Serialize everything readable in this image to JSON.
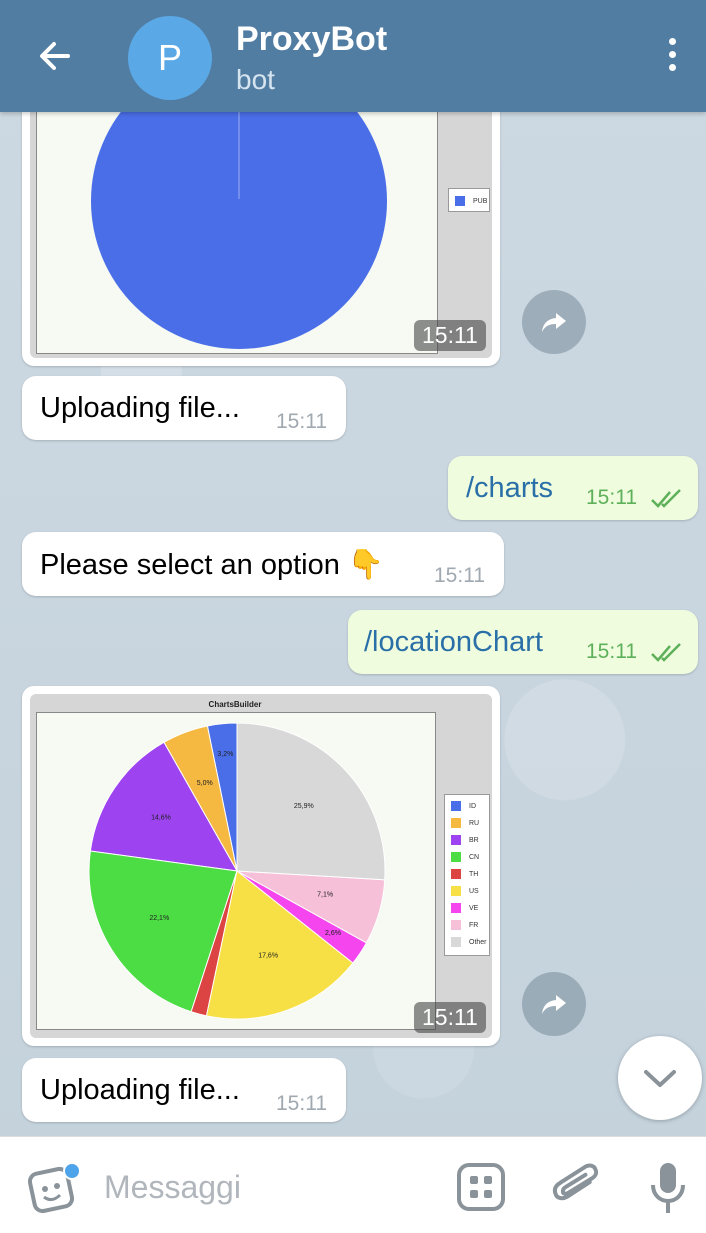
{
  "header": {
    "title": "ProxyBot",
    "subtitle": "bot",
    "avatar_letter": "P"
  },
  "messages": [
    {
      "type": "image",
      "direction": "in",
      "time": "15:11"
    },
    {
      "type": "text",
      "direction": "in",
      "text": "Uploading file...",
      "time": "15:11"
    },
    {
      "type": "text",
      "direction": "out",
      "text": "/charts",
      "time": "15:11"
    },
    {
      "type": "text",
      "direction": "in",
      "text": "Please select an option 👇",
      "time": "15:11"
    },
    {
      "type": "text",
      "direction": "out",
      "text": "/locationChart",
      "time": "15:11"
    },
    {
      "type": "image",
      "direction": "in",
      "time": "15:11"
    },
    {
      "type": "text",
      "direction": "in",
      "text": "Uploading file...",
      "time": "15:11"
    }
  ],
  "chart_top": {
    "legend": [
      "PUB"
    ]
  },
  "chart_data": {
    "type": "pie",
    "title": "ChartsBuilder",
    "categories": [
      "ID",
      "RU",
      "BR",
      "CN",
      "TH",
      "US",
      "VE",
      "FR",
      "Other"
    ],
    "values": [
      3.2,
      5.0,
      14.6,
      22.1,
      1.7,
      17.6,
      2.6,
      7.1,
      25.9
    ],
    "labels": [
      "3,2%",
      "5,0%",
      "14,6%",
      "22,1%",
      "",
      "17,6%",
      "2,6%",
      "7,1%",
      "25,9%"
    ],
    "colors": [
      "#4a6ee8",
      "#f5b942",
      "#9d44f0",
      "#4cdc44",
      "#dc4444",
      "#f7e045",
      "#f545ef",
      "#f5c0d8",
      "#d8d8d8"
    ],
    "legend_position": "right"
  },
  "input": {
    "placeholder": "Messaggi"
  }
}
